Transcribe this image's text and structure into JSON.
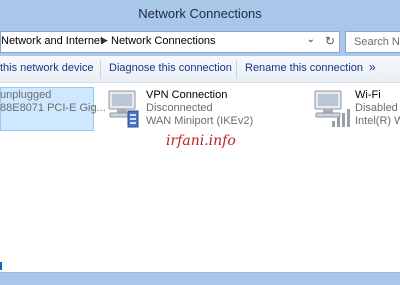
{
  "window": {
    "title": "Network Connections"
  },
  "address": {
    "crumb1": "Network and Internet",
    "crumb2": "Network Connections",
    "dropdown": "⌄",
    "refresh": "↻",
    "search_placeholder": "Search Ne"
  },
  "commands": {
    "c1": "this network device",
    "c2": "Diagnose this connection",
    "c3": "Rename this connection",
    "more": "»"
  },
  "items": [
    {
      "name": "",
      "status": "unplugged",
      "device": "88E8071 PCI-E Gig..."
    },
    {
      "name": "VPN Connection",
      "status": "Disconnected",
      "device": "WAN Miniport (IKEv2)"
    },
    {
      "name": "Wi-Fi",
      "status": "Disabled",
      "device": "Intel(R) Wir"
    }
  ],
  "watermark": "irfani.info",
  "colors": {
    "titlebar": "#a9c7e8",
    "selection": "#cde8ff",
    "link": "#1e3287",
    "watermark": "#c02020"
  }
}
